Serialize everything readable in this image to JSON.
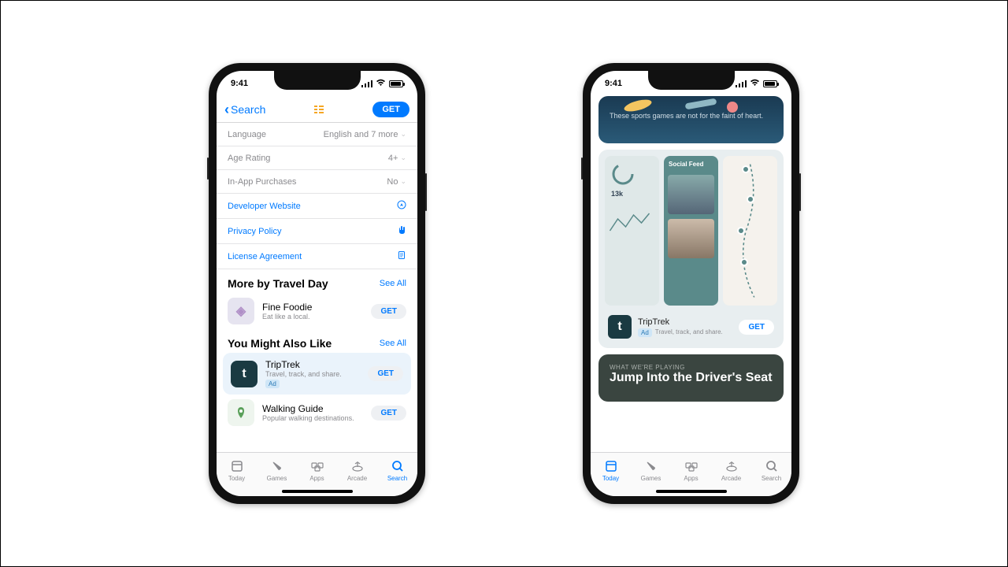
{
  "status": {
    "time": "9:41"
  },
  "phone1": {
    "nav": {
      "back": "Search",
      "get": "GET"
    },
    "info_rows": [
      {
        "label": "Language",
        "value": "English and 7 more"
      },
      {
        "label": "Age Rating",
        "value": "4+"
      },
      {
        "label": "In-App Purchases",
        "value": "No"
      }
    ],
    "link_rows": [
      {
        "label": "Developer Website"
      },
      {
        "label": "Privacy Policy"
      },
      {
        "label": "License Agreement"
      }
    ],
    "more_by": {
      "title": "More by Travel Day",
      "see_all": "See All",
      "apps": [
        {
          "name": "Fine Foodie",
          "sub": "Eat like a local.",
          "get": "GET",
          "icon_bg": "#e6e4f0",
          "icon_fg": "#b08fc7",
          "letter": "◈"
        }
      ]
    },
    "also_like": {
      "title": "You Might Also Like",
      "see_all": "See All",
      "apps": [
        {
          "name": "TripTrek",
          "sub": "Travel, track, and share.",
          "get": "GET",
          "ad": "Ad",
          "icon_bg": "#1a3a42",
          "letter": "t",
          "highlight": true
        },
        {
          "name": "Walking Guide",
          "sub": "Popular walking destinations.",
          "get": "GET",
          "icon_bg": "#eef5ee",
          "icon_fg": "#5aa05a",
          "letter": "⬤"
        }
      ]
    }
  },
  "phone2": {
    "hero": {
      "text": "These sports games are not for the faint of heart."
    },
    "promo": {
      "social_feed": "Social Feed",
      "name": "TripTrek",
      "sub": "Travel, track, and share.",
      "ad": "Ad",
      "get": "GET",
      "stat": "13k"
    },
    "story": {
      "eyebrow": "WHAT WE'RE PLAYING",
      "title": "Jump Into the Driver's Seat"
    }
  },
  "tabs": [
    {
      "id": "today",
      "label": "Today"
    },
    {
      "id": "games",
      "label": "Games"
    },
    {
      "id": "apps",
      "label": "Apps"
    },
    {
      "id": "arcade",
      "label": "Arcade"
    },
    {
      "id": "search",
      "label": "Search"
    }
  ]
}
